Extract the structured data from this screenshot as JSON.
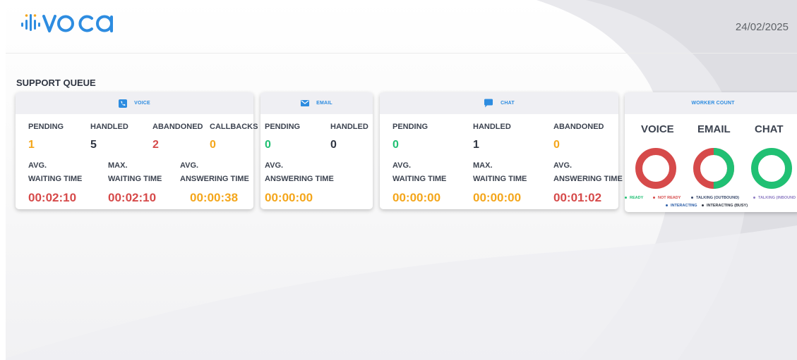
{
  "header": {
    "logo_text": "VOCA",
    "date": "24/02/2025"
  },
  "section_title": "SUPPORT QUEUE",
  "voice": {
    "title": "VOICE",
    "icon": "phone-icon",
    "col_pending": "PENDING",
    "col_handled": "HANDLED",
    "col_abandoned": "ABANDONED",
    "col_callbacks": "CALLBACKS",
    "pending": "1",
    "handled": "5",
    "abandoned": "2",
    "callbacks": "0",
    "avg_wait_l1": "AVG.",
    "avg_wait_l2": "WAITING TIME",
    "max_wait_l1": "MAX.",
    "max_wait_l2": "WAITING TIME",
    "avg_ans_l1": "AVG.",
    "avg_ans_l2": "ANSWERING TIME",
    "avg_wait": "00:02:10",
    "max_wait": "00:02:10",
    "avg_ans": "00:00:38"
  },
  "email": {
    "title": "EMAIL",
    "icon": "envelope-icon",
    "col_pending": "PENDING",
    "col_handled": "HANDLED",
    "pending": "0",
    "handled": "0",
    "avg_ans_l1": "AVG.",
    "avg_ans_l2": "ANSWERING TIME",
    "avg_ans": "00:00:00"
  },
  "chat": {
    "title": "CHAT",
    "icon": "chat-bubble-icon",
    "col_pending": "PENDING",
    "col_handled": "HANDLED",
    "col_abandoned": "ABANDONED",
    "pending": "0",
    "handled": "1",
    "abandoned": "0",
    "avg_wait_l1": "AVG.",
    "avg_wait_l2": "WAITING TIME",
    "max_wait_l1": "MAX.",
    "max_wait_l2": "WAITING TIME",
    "avg_ans_l1": "AVG.",
    "avg_ans_l2": "ANSWERING TIME",
    "avg_wait": "00:00:00",
    "max_wait": "00:00:00",
    "avg_ans": "00:01:02"
  },
  "worker_count": {
    "title": "WORKER COUNT",
    "donuts": [
      {
        "label": "VOICE",
        "ready_fraction": 0.0
      },
      {
        "label": "EMAIL",
        "ready_fraction": 0.5
      },
      {
        "label": "CHAT",
        "ready_fraction": 1.0
      }
    ],
    "legend": [
      {
        "label": "READY",
        "color": "#20c073"
      },
      {
        "label": "NOT READY",
        "color": "#d64a4a"
      },
      {
        "label": "TALKING (OUTBOUND)",
        "color": "#3a4a6b"
      },
      {
        "label": "TALKING (INBOUND",
        "color": "#8e7cc3"
      },
      {
        "label": "INTERACTING",
        "color": "#2d5fa8"
      },
      {
        "label": "INTERACTING (BUSY)",
        "color": "#2f3542"
      }
    ]
  },
  "colors": {
    "pending": "#f4a61b",
    "handled": "#2f3542",
    "abandoned": "#d64a4a",
    "zero": "#20c073",
    "accent_blue": "#2d8ce0"
  }
}
